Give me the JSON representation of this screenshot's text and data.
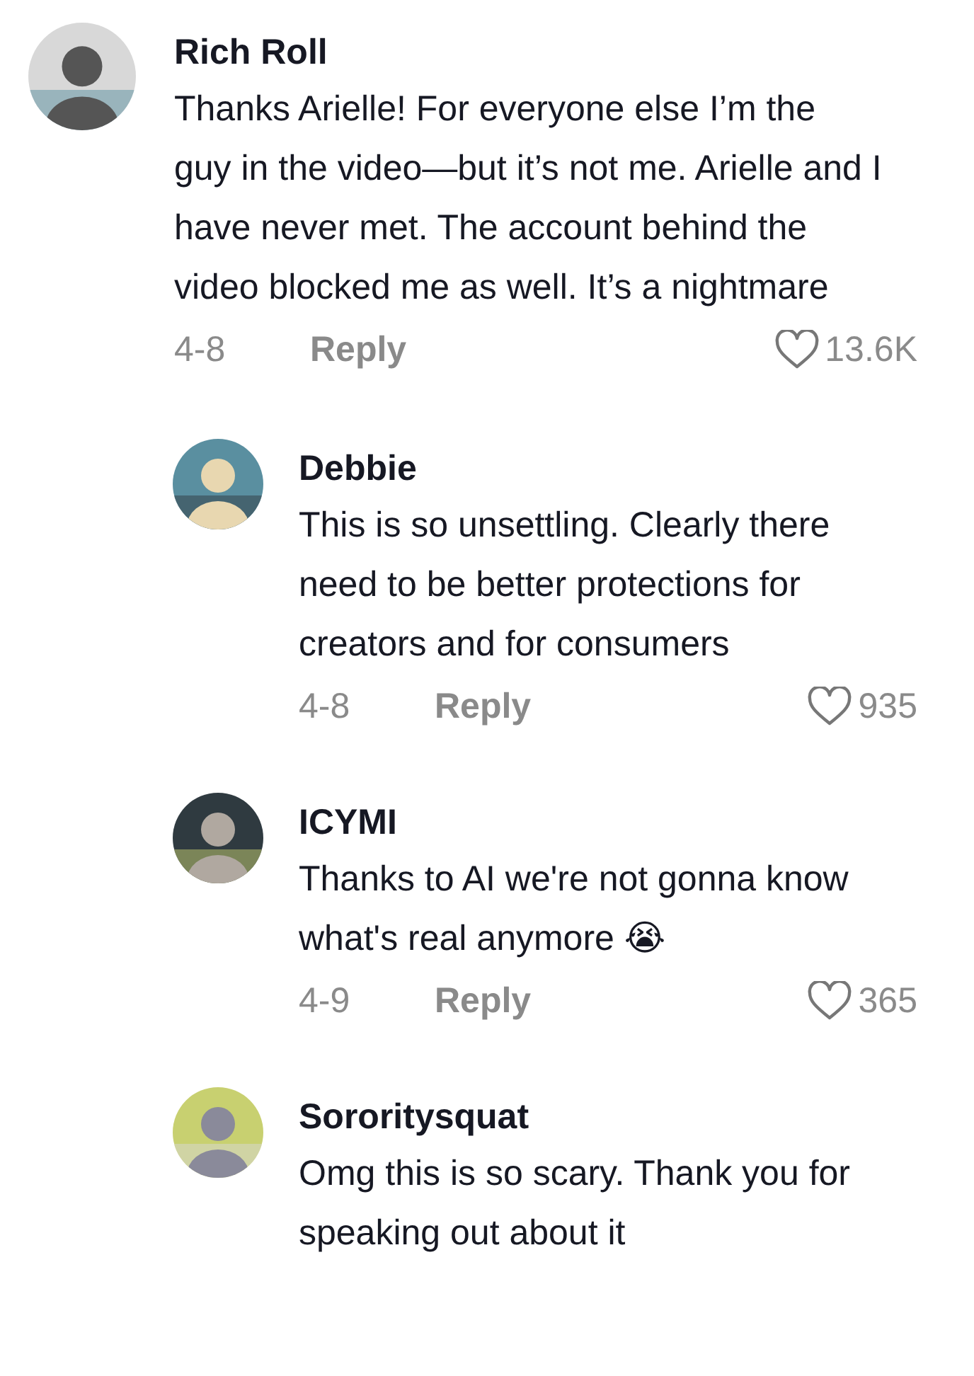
{
  "comments": [
    {
      "user": "Rich Roll",
      "text": "Thanks Arielle! For everyone else I’m the guy in the video—but it’s not me. Arielle and I have never met. The account behind the video blocked me as well. It’s a nightmare",
      "date": "4-8",
      "reply": "Reply",
      "likes": "13.6K",
      "replies": [
        {
          "user": "Debbie",
          "text": "This is so unsettling. Clearly there need to be better protections for creators and for consumers",
          "date": "4-8",
          "reply": "Reply",
          "likes": "935"
        },
        {
          "user": "ICYMI",
          "text": "Thanks to AI we're not gonna know what's real anymore 😭",
          "date": "4-9",
          "reply": "Reply",
          "likes": "365"
        },
        {
          "user": "Sororitysquat",
          "text": "Omg this is so scary. Thank you for speaking out about it"
        }
      ]
    }
  ]
}
